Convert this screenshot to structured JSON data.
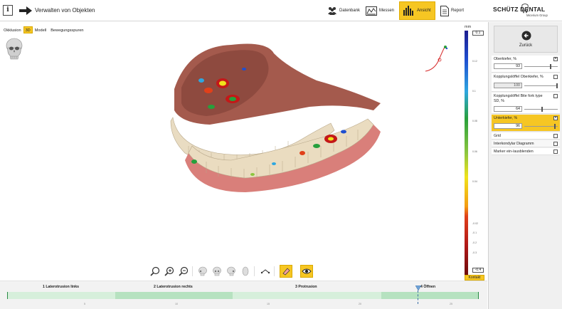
{
  "header": {
    "info_glyph": "i",
    "title": "Verwalten von Objekten",
    "buttons": [
      {
        "label": "Datenbank",
        "icon": "people-icon",
        "active": false
      },
      {
        "label": "Messen",
        "icon": "measure-icon",
        "active": false
      },
      {
        "label": "Ansicht",
        "icon": "bar-chart-icon",
        "active": true
      },
      {
        "label": "Report",
        "icon": "document-icon",
        "active": false
      }
    ],
    "logo_main": "SCHÜTZ DENTAL",
    "logo_sub": "Micerium Group"
  },
  "view_tabs": [
    {
      "label": "Okklusion",
      "active": false
    },
    {
      "label": "3D",
      "active": true
    },
    {
      "label": "Modell",
      "active": false
    },
    {
      "label": "Bewegungsspuren",
      "active": false
    }
  ],
  "scale": {
    "unit": "mm",
    "max_value": "0.1",
    "min_value": "-0.4",
    "ticks": [
      "0.1",
      "0.12",
      "0.1",
      "0.08",
      "0.06",
      "0.04",
      "0.02",
      "0",
      "-0.02",
      "-0.1",
      "-0.2",
      "-0.3",
      "-0.4"
    ],
    "contact_label": "Kontakt",
    "colors": [
      "#1d1d8f",
      "#1f4fd0",
      "#2ea7e0",
      "#27a03c",
      "#8cc63f",
      "#f0e21b",
      "#f39c12",
      "#e0401a",
      "#b01818",
      "#6e0c0c"
    ]
  },
  "tools": [
    {
      "name": "zoom-fit-icon",
      "active": false
    },
    {
      "name": "zoom-in-icon",
      "active": false
    },
    {
      "name": "zoom-out-icon",
      "active": false
    },
    {
      "name": "skull-left-icon",
      "active": false
    },
    {
      "name": "skull-front-icon",
      "active": false
    },
    {
      "name": "skull-right-icon",
      "active": false
    },
    {
      "name": "skull-bottom-icon",
      "active": false
    },
    {
      "name": "measure-line-icon",
      "active": false
    },
    {
      "name": "eraser-icon",
      "active": true
    },
    {
      "name": "eye-icon",
      "active": true
    }
  ],
  "timeline": {
    "phases": [
      "1 Laterotrusion links",
      "2 Laterotrusion rechts",
      "3 Protrusion",
      "4 Öffnen"
    ],
    "ticks": [
      "0",
      "5",
      "10",
      "15",
      "20",
      "25"
    ]
  },
  "panel": {
    "back_label": "Zurück",
    "rows": [
      {
        "label": "Oberkiefer, %",
        "value": "93",
        "checked": true,
        "highlight": false
      },
      {
        "label": "Kopplungslöffel Oberkiefer, %",
        "value": "100",
        "checked": false,
        "highlight": false
      },
      {
        "label": "Kopplungslöffel Bite fork type SD, %",
        "value": "64",
        "checked": false,
        "highlight": false
      },
      {
        "label": "Unterkiefer, %",
        "value": "96",
        "checked": true,
        "highlight": true
      },
      {
        "label": "Grid",
        "checked": false
      },
      {
        "label": "Interkondylar Diagramm",
        "checked": false
      },
      {
        "label": "Marker ein-/ausblenden",
        "checked": false
      }
    ],
    "check_glyph": "×"
  }
}
